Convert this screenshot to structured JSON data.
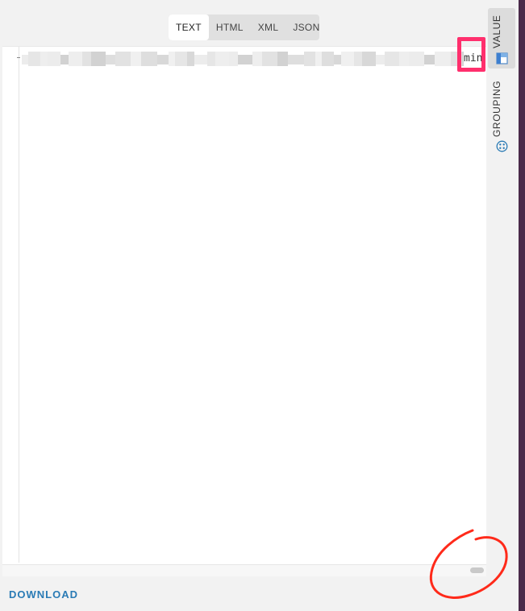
{
  "tabs": [
    {
      "label": "TEXT",
      "active": true
    },
    {
      "label": "HTML",
      "active": false
    },
    {
      "label": "XML",
      "active": false
    },
    {
      "label": "JSON",
      "active": false
    }
  ],
  "editor": {
    "line_1_visible_tail": "min"
  },
  "side_tools": [
    {
      "label": "VALUE",
      "icon": "value-table-icon",
      "active": true
    },
    {
      "label": "GROUPING",
      "icon": "grouping-icon",
      "active": false
    }
  ],
  "footer": {
    "download_label": "DOWNLOAD"
  },
  "colors": {
    "accent": "#2a7bb5",
    "highlight": "#ff2f6d",
    "annotation": "#ff2a1a"
  }
}
